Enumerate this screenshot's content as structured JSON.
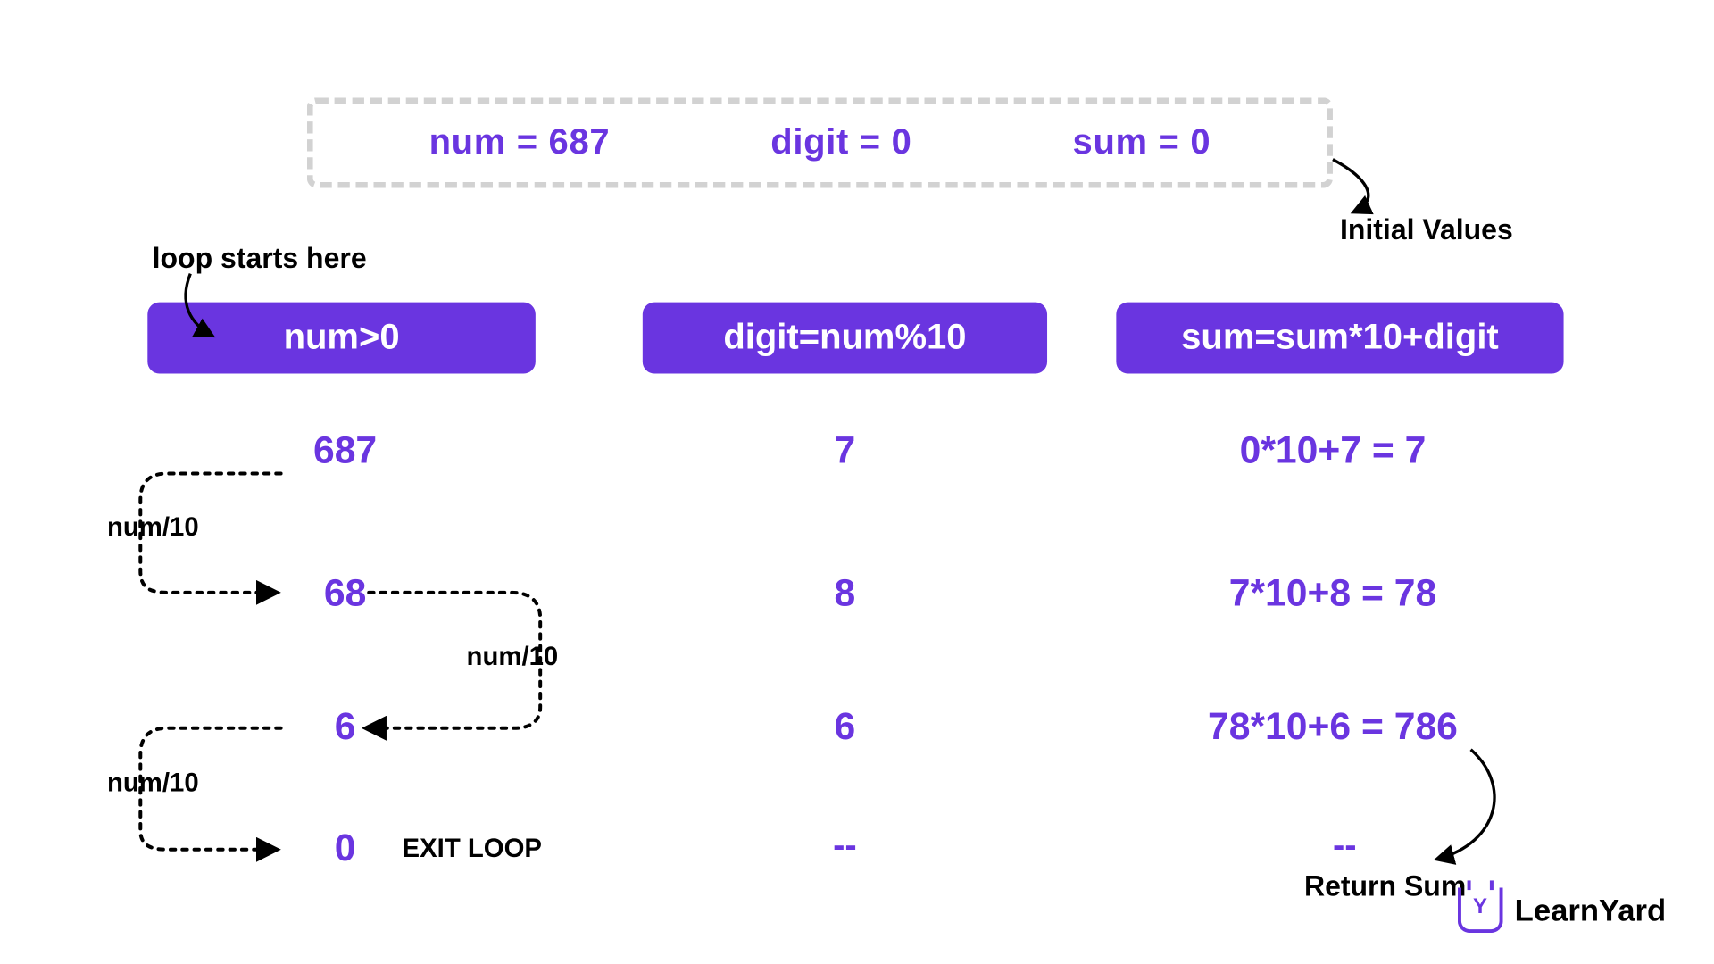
{
  "initial": {
    "num": "num = 687",
    "digit": "digit =  0",
    "sum": "sum = 0"
  },
  "annotations": {
    "initial_values": "Initial Values",
    "loop_starts": "loop starts here",
    "exit_loop": "EXIT LOOP",
    "return_sum": "Return Sum",
    "num_div": "num/10"
  },
  "headers": {
    "cond": "num>0",
    "digit": "digit=num%10",
    "sum": "sum=sum*10+digit"
  },
  "rows": [
    {
      "num": "687",
      "digit": "7",
      "sum": "0*10+7 = 7"
    },
    {
      "num": "68",
      "digit": "8",
      "sum": "7*10+8 = 78"
    },
    {
      "num": "6",
      "digit": "6",
      "sum": "78*10+6 = 786"
    },
    {
      "num": "0",
      "digit": "--",
      "sum": "--"
    }
  ],
  "brand": "LearnYard"
}
